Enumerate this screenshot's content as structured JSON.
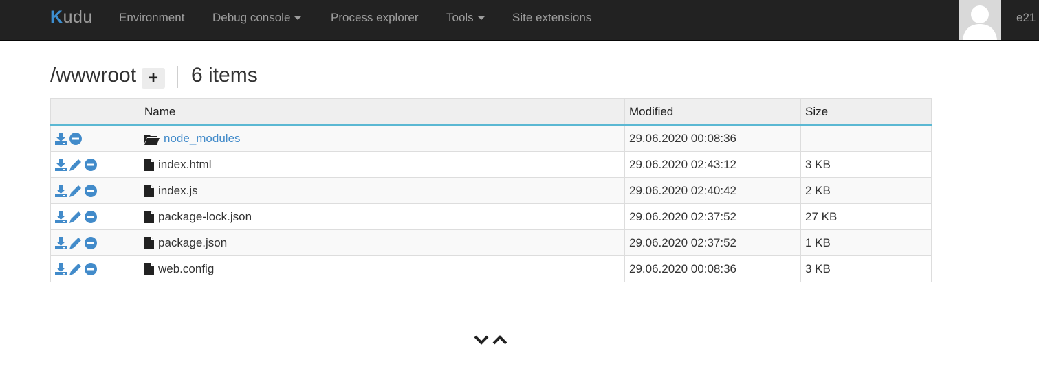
{
  "navbar": {
    "brand": "udu",
    "brand_initial": "K",
    "items": [
      {
        "label": "Environment"
      },
      {
        "label": "Debug console"
      },
      {
        "label": "Process explorer"
      },
      {
        "label": "Tools"
      },
      {
        "label": "Site extensions"
      }
    ],
    "user": "e21"
  },
  "heading": {
    "path": "/wwwroot",
    "count": "6 items"
  },
  "table": {
    "headers": [
      "Name",
      "Modified",
      "Size"
    ],
    "rows": [
      {
        "name": "node_modules",
        "type": "folder",
        "modified": "29.06.2020 00:08:36",
        "size": ""
      },
      {
        "name": "index.html",
        "type": "file",
        "modified": "29.06.2020 02:43:12",
        "size": "3 KB"
      },
      {
        "name": "index.js",
        "type": "file",
        "modified": "29.06.2020 02:40:42",
        "size": "2 KB"
      },
      {
        "name": "package-lock.json",
        "type": "file",
        "modified": "29.06.2020 02:37:52",
        "size": "27 KB"
      },
      {
        "name": "package.json",
        "type": "file",
        "modified": "29.06.2020 02:37:52",
        "size": "1 KB"
      },
      {
        "name": "web.config",
        "type": "file",
        "modified": "29.06.2020 00:08:36",
        "size": "3 KB"
      }
    ]
  },
  "colors": {
    "navbar_bg": "#222222",
    "accent": "#428bca",
    "header_border": "#5bb8d3"
  },
  "icons": [
    "download-icon",
    "edit-icon",
    "delete-icon",
    "folder-open-icon",
    "file-icon",
    "chevron-down-icon",
    "chevron-up-icon",
    "plus-icon",
    "avatar-icon"
  ]
}
